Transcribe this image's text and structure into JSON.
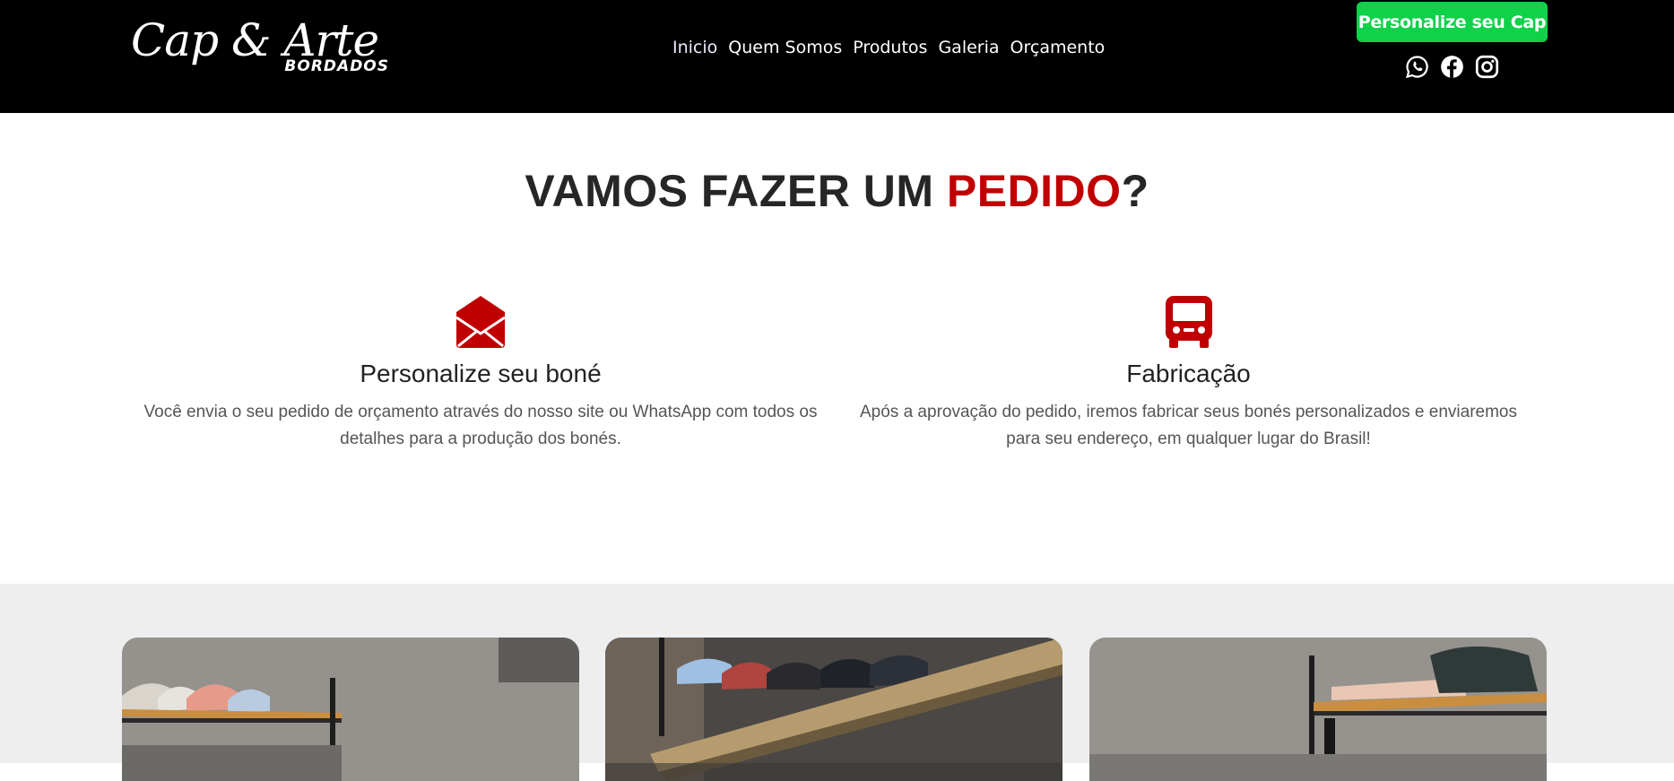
{
  "brand": {
    "logo_script": "Cap & Arte",
    "logo_sub": "BORDADOS"
  },
  "nav": {
    "items": [
      {
        "label": "Inicio"
      },
      {
        "label": "Quem Somos"
      },
      {
        "label": "Produtos"
      },
      {
        "label": "Galeria"
      },
      {
        "label": "Orçamento"
      }
    ]
  },
  "cta": {
    "label": "Personalize seu Cap",
    "color": "#0fd14a"
  },
  "socials": [
    "whatsapp-icon",
    "facebook-icon",
    "instagram-icon"
  ],
  "order": {
    "title_main": "VAMOS FAZER UM ",
    "title_accent": "PEDIDO",
    "title_end": "?",
    "accent_color": "#c00000",
    "steps": [
      {
        "icon": "envelope-open-icon",
        "title": "Personalize seu boné",
        "text": "Você envia o seu pedido de orçamento através do nosso site ou WhatsApp com todos os detalhes para a produção dos bonés."
      },
      {
        "icon": "bus-icon",
        "title": "Fabricação",
        "text": "Após a aprovação do pedido, iremos fabricar seus bonés personalizados e enviaremos para seu endereço, em qualquer lugar do Brasil!"
      }
    ]
  },
  "gallery": {
    "photos": [
      "cap-shelf-photo-1",
      "cap-shelf-photo-2",
      "cap-shelf-photo-3"
    ]
  }
}
